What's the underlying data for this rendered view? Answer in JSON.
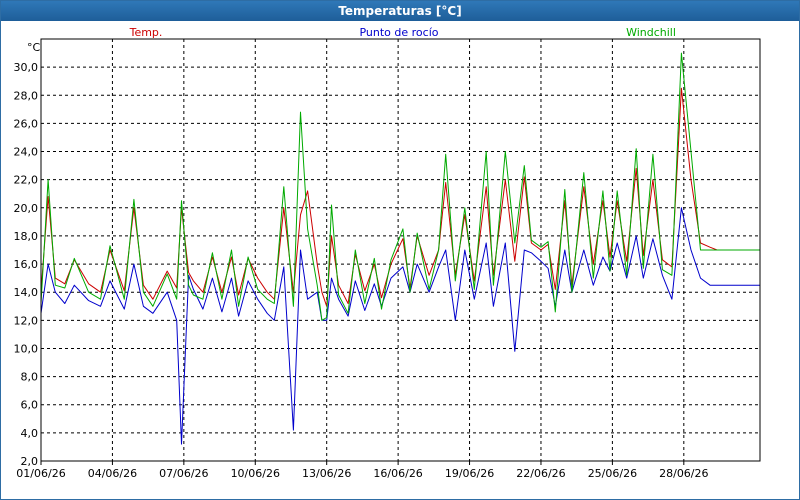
{
  "window": {
    "title": "Temperaturas [°C]"
  },
  "chart_data": {
    "type": "line",
    "y_unit_label": "°C",
    "ylim": [
      2.0,
      32.0
    ],
    "y_ticks": [
      "2,0",
      "4,0",
      "6,0",
      "8,0",
      "10,0",
      "12,0",
      "14,0",
      "16,0",
      "18,0",
      "20,0",
      "22,0",
      "24,0",
      "26,0",
      "28,0",
      "30,0"
    ],
    "y_tick_values": [
      2,
      4,
      6,
      8,
      10,
      12,
      14,
      16,
      18,
      20,
      22,
      24,
      26,
      28,
      30
    ],
    "x_ticks": [
      "01/06/26",
      "04/06/26",
      "07/06/26",
      "10/06/26",
      "13/06/26",
      "16/06/26",
      "19/06/26",
      "22/06/26",
      "25/06/26",
      "28/06/26"
    ],
    "x_tick_days": [
      0,
      3,
      6,
      9,
      12,
      15,
      18,
      21,
      24,
      27
    ],
    "xlim_days": [
      0,
      30.2
    ],
    "grid": true,
    "legend_placement": "top",
    "series": [
      {
        "name": "Temp.",
        "color": "#cc0000",
        "x_days": [
          0,
          0.3,
          0.6,
          1.0,
          1.4,
          2.0,
          2.5,
          2.9,
          3.5,
          3.9,
          4.3,
          4.7,
          5.3,
          5.7,
          5.9,
          6.2,
          6.4,
          6.8,
          7.2,
          7.6,
          8.0,
          8.3,
          8.7,
          9.1,
          9.5,
          9.8,
          10.2,
          10.6,
          10.9,
          11.2,
          11.6,
          11.8,
          12.0,
          12.2,
          12.5,
          12.9,
          13.2,
          13.6,
          14.0,
          14.3,
          14.7,
          15.2,
          15.5,
          15.8,
          16.3,
          16.7,
          17.0,
          17.4,
          17.8,
          18.2,
          18.7,
          19.0,
          19.5,
          19.9,
          20.3,
          20.6,
          21.0,
          21.3,
          21.6,
          22.0,
          22.3,
          22.8,
          23.2,
          23.6,
          23.9,
          24.2,
          24.6,
          25.0,
          25.3,
          25.7,
          26.1,
          26.5,
          26.9,
          27.3,
          27.7,
          28.1,
          28.4,
          28.9,
          29.3,
          29.6,
          29.9,
          30.2
        ],
        "values": [
          14.0,
          20.8,
          15.0,
          14.6,
          16.3,
          14.6,
          14.0,
          17.0,
          14.1,
          20.0,
          14.5,
          13.5,
          15.5,
          14.3,
          20.0,
          15.4,
          14.8,
          14.0,
          16.5,
          14.0,
          16.5,
          13.8,
          16.4,
          15.0,
          14.0,
          13.5,
          20.0,
          14.0,
          19.5,
          21.2,
          16.0,
          14.0,
          13.0,
          18.0,
          14.5,
          13.2,
          16.7,
          14.1,
          16.0,
          13.6,
          16.0,
          17.8,
          14.3,
          18.0,
          15.2,
          17.0,
          21.8,
          15.2,
          19.5,
          14.8,
          21.5,
          15.2,
          22.0,
          16.2,
          22.2,
          17.5,
          17.0,
          17.4,
          14.2,
          20.5,
          14.5,
          21.5,
          16.0,
          20.5,
          16.5,
          20.5,
          16.2,
          22.8,
          16.6,
          22.0,
          16.3,
          15.8,
          28.5,
          22.0,
          17.5,
          17.2,
          17.0,
          17.0,
          17.0,
          17.0,
          17.0,
          17.0
        ]
      },
      {
        "name": "Punto de rocío",
        "color": "#0000cc",
        "x_days": [
          0,
          0.3,
          0.6,
          1.0,
          1.4,
          2.0,
          2.5,
          2.9,
          3.5,
          3.9,
          4.3,
          4.7,
          5.3,
          5.7,
          5.9,
          6.2,
          6.4,
          6.8,
          7.2,
          7.6,
          8.0,
          8.3,
          8.7,
          9.1,
          9.5,
          9.8,
          10.2,
          10.6,
          10.9,
          11.2,
          11.6,
          11.8,
          12.0,
          12.2,
          12.5,
          12.9,
          13.2,
          13.6,
          14.0,
          14.3,
          14.7,
          15.2,
          15.5,
          15.8,
          16.3,
          16.7,
          17.0,
          17.4,
          17.8,
          18.2,
          18.7,
          19.0,
          19.5,
          19.9,
          20.3,
          20.6,
          21.0,
          21.3,
          21.6,
          22.0,
          22.3,
          22.8,
          23.2,
          23.6,
          23.9,
          24.2,
          24.6,
          25.0,
          25.3,
          25.7,
          26.1,
          26.5,
          26.9,
          27.3,
          27.7,
          28.1,
          28.4,
          28.9,
          29.3,
          29.6,
          29.9,
          30.2
        ],
        "values": [
          12.5,
          16.0,
          14.0,
          13.2,
          14.5,
          13.4,
          13.0,
          14.8,
          12.8,
          16.0,
          13.0,
          12.5,
          14.0,
          12.0,
          3.2,
          15.2,
          14.2,
          12.8,
          15.0,
          12.6,
          15.0,
          12.3,
          14.8,
          13.5,
          12.5,
          12.0,
          15.8,
          4.2,
          17.0,
          13.5,
          14.0,
          12.0,
          12.0,
          15.0,
          13.5,
          12.3,
          14.8,
          12.7,
          14.6,
          13.0,
          15.0,
          15.8,
          14.0,
          16.0,
          14.0,
          15.8,
          17.0,
          12.0,
          17.0,
          13.5,
          17.5,
          13.0,
          17.5,
          9.8,
          17.0,
          16.8,
          16.2,
          15.7,
          13.0,
          17.0,
          14.0,
          17.0,
          14.5,
          16.5,
          15.5,
          17.5,
          15.0,
          18.0,
          15.0,
          17.8,
          15.2,
          13.5,
          20.0,
          17.0,
          15.0,
          14.5,
          14.5,
          14.5,
          14.5,
          14.5,
          14.5,
          14.5
        ]
      },
      {
        "name": "Windchill",
        "color": "#00aa00",
        "x_days": [
          0,
          0.3,
          0.6,
          1.0,
          1.4,
          2.0,
          2.5,
          2.9,
          3.5,
          3.9,
          4.3,
          4.7,
          5.3,
          5.7,
          5.9,
          6.2,
          6.4,
          6.8,
          7.2,
          7.6,
          8.0,
          8.3,
          8.7,
          9.1,
          9.5,
          9.8,
          10.2,
          10.6,
          10.9,
          11.2,
          11.6,
          11.8,
          12.0,
          12.2,
          12.5,
          12.9,
          13.2,
          13.6,
          14.0,
          14.3,
          14.7,
          15.2,
          15.5,
          15.8,
          16.3,
          16.7,
          17.0,
          17.4,
          17.8,
          18.2,
          18.7,
          19.0,
          19.5,
          19.9,
          20.3,
          20.6,
          21.0,
          21.3,
          21.6,
          22.0,
          22.3,
          22.8,
          23.2,
          23.6,
          23.9,
          24.2,
          24.6,
          25.0,
          25.3,
          25.7,
          26.1,
          26.5,
          26.9,
          27.3,
          27.7,
          28.1,
          28.4,
          28.9,
          29.3,
          29.6,
          29.9,
          30.2
        ],
        "values": [
          13.2,
          22.0,
          14.5,
          14.3,
          16.4,
          14.0,
          13.5,
          17.3,
          13.5,
          20.6,
          14.0,
          13.0,
          15.3,
          13.5,
          20.5,
          14.5,
          13.8,
          13.5,
          16.8,
          13.5,
          17.0,
          13.0,
          16.5,
          14.2,
          13.5,
          13.2,
          21.5,
          13.0,
          26.8,
          18.5,
          14.5,
          12.0,
          12.2,
          20.2,
          13.8,
          12.5,
          17.0,
          13.2,
          16.4,
          12.8,
          16.3,
          18.5,
          14.0,
          18.2,
          14.2,
          17.0,
          23.8,
          14.8,
          20.0,
          14.2,
          24.0,
          14.5,
          24.0,
          17.5,
          23.0,
          17.7,
          17.2,
          17.6,
          12.6,
          21.3,
          14.0,
          22.5,
          15.0,
          21.2,
          15.5,
          21.2,
          15.2,
          24.2,
          15.7,
          23.8,
          15.6,
          15.2,
          31.0,
          24.0,
          17.0,
          17.0,
          17.0,
          17.0,
          17.0,
          17.0,
          17.0,
          17.0
        ]
      }
    ]
  }
}
